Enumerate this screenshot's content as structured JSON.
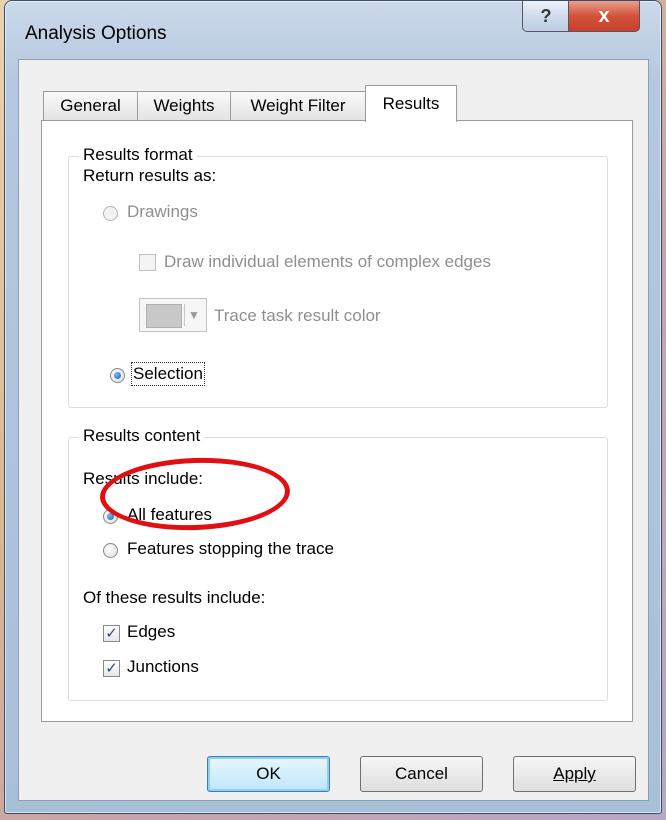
{
  "window": {
    "title": "Analysis Options",
    "help_label": "?",
    "close_label": "x"
  },
  "tabs": [
    {
      "label": "General"
    },
    {
      "label": "Weights"
    },
    {
      "label": "Weight Filter"
    },
    {
      "label": "Results",
      "active": true
    }
  ],
  "results_format": {
    "legend": "Results format",
    "return_label": "Return results as:",
    "drawings_label": "Drawings",
    "draw_individual_label": "Draw individual elements of complex edges",
    "trace_color_label": "Trace task result color",
    "selection_label": "Selection",
    "selected_option": "Selection",
    "trace_color_hex": "#c8c8c8"
  },
  "results_content": {
    "legend": "Results content",
    "include_label": "Results include:",
    "all_features_label": "All features",
    "stopping_label": "Features stopping the trace",
    "selected_option": "All features",
    "of_these_label": "Of these results include:",
    "edges_label": "Edges",
    "junctions_label": "Junctions",
    "check_mark": "✓"
  },
  "buttons": {
    "ok": "OK",
    "cancel": "Cancel",
    "apply": "Apply"
  },
  "annotation": {
    "highlight_color": "#e10e12"
  }
}
